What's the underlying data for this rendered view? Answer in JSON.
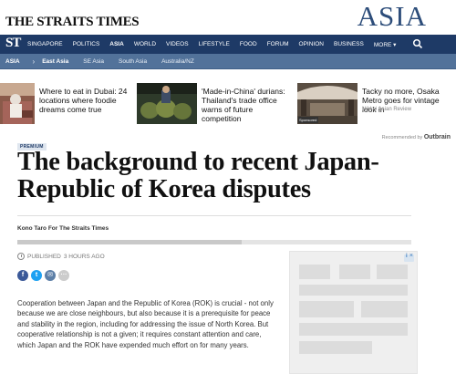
{
  "masthead": {
    "brand": "THE STRAITS TIMES",
    "edition": "ASIA"
  },
  "nav": {
    "logo": "ST",
    "items": [
      {
        "label": "SINGAPORE",
        "active": false
      },
      {
        "label": "POLITICS",
        "active": false
      },
      {
        "label": "ASIA",
        "active": true
      },
      {
        "label": "WORLD",
        "active": false
      },
      {
        "label": "VIDEOS",
        "active": false
      },
      {
        "label": "LIFESTYLE",
        "active": false
      },
      {
        "label": "FOOD",
        "active": false
      },
      {
        "label": "FORUM",
        "active": false
      },
      {
        "label": "OPINION",
        "active": false
      },
      {
        "label": "BUSINESS",
        "active": false
      },
      {
        "label": "MORE ▾",
        "active": false
      }
    ],
    "search_icon": "search-icon"
  },
  "subnav": {
    "section": "ASIA",
    "chevron": "›",
    "items": [
      {
        "label": "East Asia",
        "active": true
      },
      {
        "label": "SE Asia",
        "active": false
      },
      {
        "label": "South Asia",
        "active": false
      },
      {
        "label": "Australia/NZ",
        "active": false
      }
    ]
  },
  "recommendations": [
    {
      "title": "Where to eat in Dubai: 24 locations where foodie dreams come true",
      "source": ""
    },
    {
      "title": "'Made-in-China' durians: Thailand's trade office warns of future competition",
      "source": ""
    },
    {
      "title": "Tacky no more, Osaka Metro goes for vintage look in",
      "source": "Nikkei Asian Review",
      "badge": "Sponsored"
    }
  ],
  "outbrain": {
    "label": "Recommended by",
    "brand": "Outbrain",
    "icon": "outbrain-logo-icon"
  },
  "article": {
    "premium_label": "PREMIUM",
    "headline": "The background to recent Japan-Republic of Korea disputes",
    "byline": "Kono Taro For The Straits Times",
    "read_progress": 0.57,
    "published_label": "PUBLISHED",
    "published_time": "3 HOURS AGO",
    "share": {
      "facebook": "f",
      "twitter": "t",
      "email": "✉",
      "more": "···"
    },
    "body": "Cooperation between Japan and the Republic of Korea (ROK) is crucial - not only because we are close neighbours, but also because it is a prerequisite for peace and stability in the region, including for addressing the issue of North Korea. But cooperative relationship is not a given; it requires constant attention and care, which Japan and the ROK have expended much effort on for many years."
  },
  "colors": {
    "nav_bg": "#1e3a66",
    "subnav_bg": "#52729a",
    "edition": "#2d4d7a"
  }
}
